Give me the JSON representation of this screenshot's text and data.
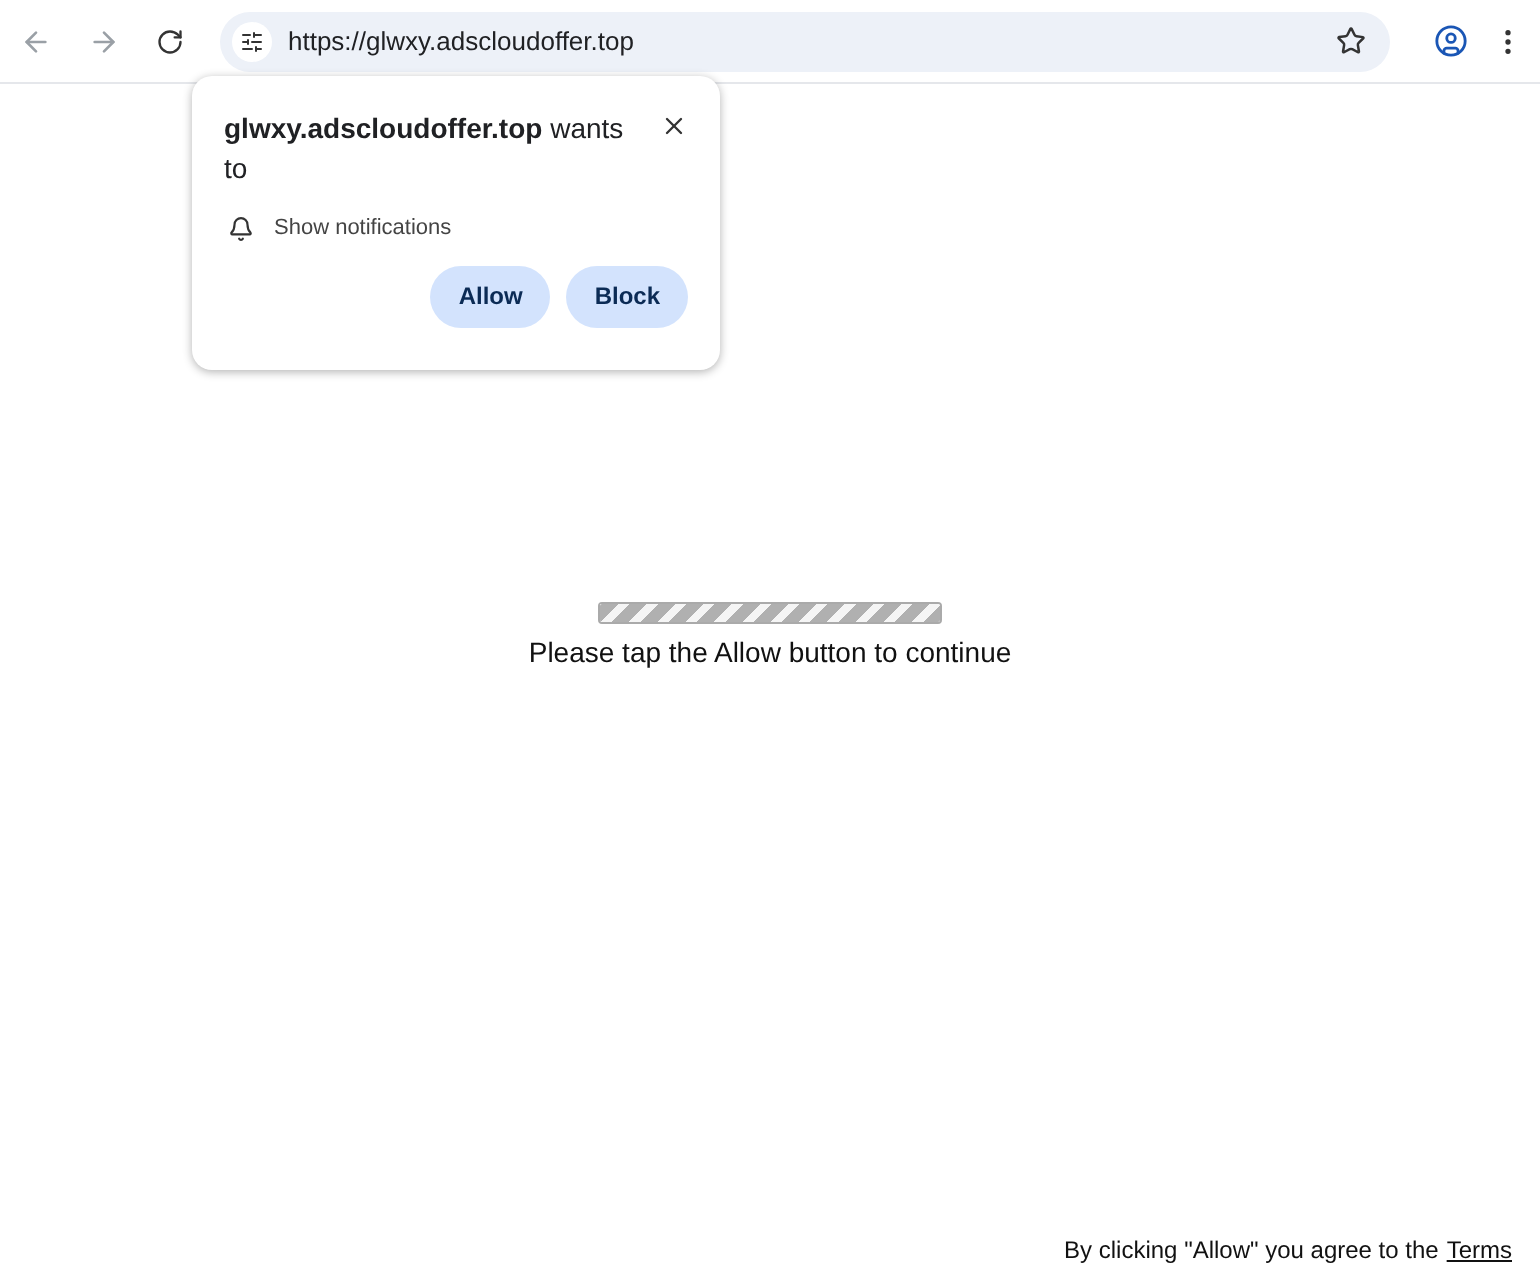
{
  "address_bar": {
    "url": "https://glwxy.adscloudoffer.top"
  },
  "permission_popup": {
    "site": "glwxy.adscloudoffer.top",
    "suffix": "wants to",
    "permission": "Show notifications",
    "buttons": [
      "Allow",
      "Block"
    ]
  },
  "page": {
    "progress": {
      "level": 1
    },
    "message": "Please tap the Allow button to continue"
  },
  "footer": {
    "text": "By clicking \"Allow\" you agree to the",
    "link": "Terms"
  }
}
